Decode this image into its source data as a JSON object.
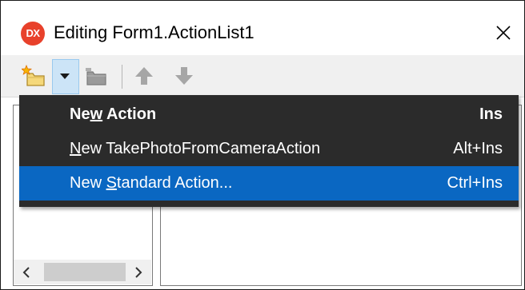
{
  "window": {
    "title": "Editing Form1.ActionList1",
    "app_icon_text": "DX",
    "app_icon_color": "#e8412b"
  },
  "toolbar": {
    "icons": [
      "new-action-icon",
      "dropdown-arrow-icon",
      "new-category-icon",
      "move-up-icon",
      "move-down-icon"
    ]
  },
  "menu": {
    "items": [
      {
        "pre": "Ne",
        "accel": "w",
        "post": " Action",
        "shortcut": "Ins",
        "bold": true,
        "selected": false
      },
      {
        "pre": "",
        "accel": "N",
        "post": "ew TakePhotoFromCameraAction",
        "shortcut": "Alt+Ins",
        "bold": false,
        "selected": false
      },
      {
        "pre": "New ",
        "accel": "S",
        "post": "tandard Action...",
        "shortcut": "Ctrl+Ins",
        "bold": false,
        "selected": true
      }
    ],
    "background": "#2b2b2b",
    "selected_color": "#0a67c2"
  },
  "scrollbar": {
    "left_arrow": "‹",
    "right_arrow": "›"
  }
}
